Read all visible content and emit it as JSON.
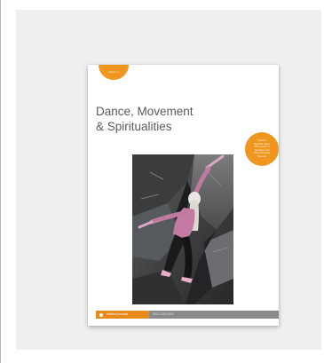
{
  "colors": {
    "panel_background": "#efefef",
    "accent_orange": "#f0961f",
    "footer_gray": "#8a8a8a",
    "title_gray": "#5a5a5a"
  },
  "cover": {
    "title_line_1": "Dance, Movement",
    "title_line_2": "& Spiritualities",
    "volume_badge": "Volume 1",
    "issue_badge_lines": [
      "Issue 1",
      "Special Issue",
      "Movement in",
      "Spiritual and",
      "Psychological",
      "Spaces"
    ],
    "photo_icon": "dancer-photo",
    "publisher": "intellect",
    "publisher_suffix": "journals",
    "issn": "ISSN 2051-5804"
  }
}
